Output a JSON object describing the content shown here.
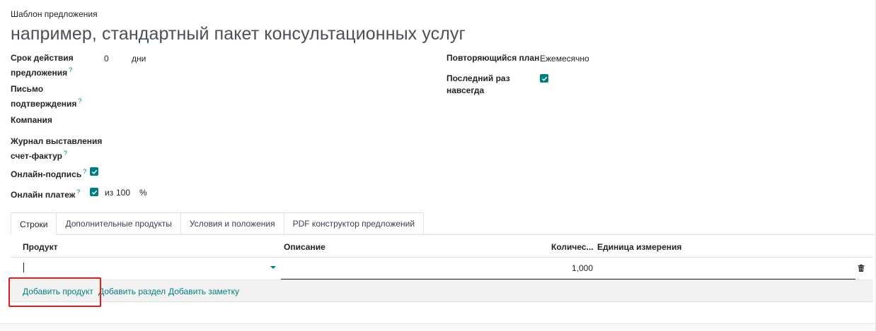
{
  "template": {
    "label": "Шаблон предложения",
    "name_placeholder": "например, стандартный пакет консультационных услуг"
  },
  "fields": {
    "validity": {
      "label_line1": "Срок действия",
      "label_line2": "предложения",
      "help": "?",
      "value": "0",
      "unit": "дни"
    },
    "confirmation_mail": {
      "label_line1": "Письмо",
      "label_line2": "подтверждения",
      "help": "?"
    },
    "company": {
      "label": "Компания"
    },
    "journal": {
      "label_line1": "Журнал выставления",
      "label_line2": "счет-фактур",
      "help": "?"
    },
    "online_signature": {
      "label": "Онлайн-подпись",
      "help": "?",
      "checked": true
    },
    "online_payment": {
      "label": "Онлайн платеж",
      "help": "?",
      "checked": true,
      "prefix": "из",
      "value": "100",
      "suffix": "%"
    },
    "recurring_plan": {
      "label": "Повторяющийся план",
      "value": "Ежемесячно"
    },
    "last_forever": {
      "label_line1": "Последний раз",
      "label_line2": "навсегда",
      "checked": true
    }
  },
  "tabs": [
    {
      "label": "Строки",
      "active": true
    },
    {
      "label": "Дополнительные продукты",
      "active": false
    },
    {
      "label": "Условия и положения",
      "active": false
    },
    {
      "label": "PDF конструктор предложений",
      "active": false
    }
  ],
  "table": {
    "columns": [
      "Продукт",
      "Описание",
      "Количес...",
      "Единица измерения"
    ],
    "rows": [
      {
        "product": "",
        "description": "",
        "quantity": "1,000",
        "uom": ""
      }
    ],
    "actions": {
      "add_product": "Добавить продукт",
      "add_section": "Добавить раздел",
      "add_note": "Добавить заметку"
    }
  },
  "colors": {
    "accent": "#017e84",
    "highlight": "#e51a1a"
  }
}
